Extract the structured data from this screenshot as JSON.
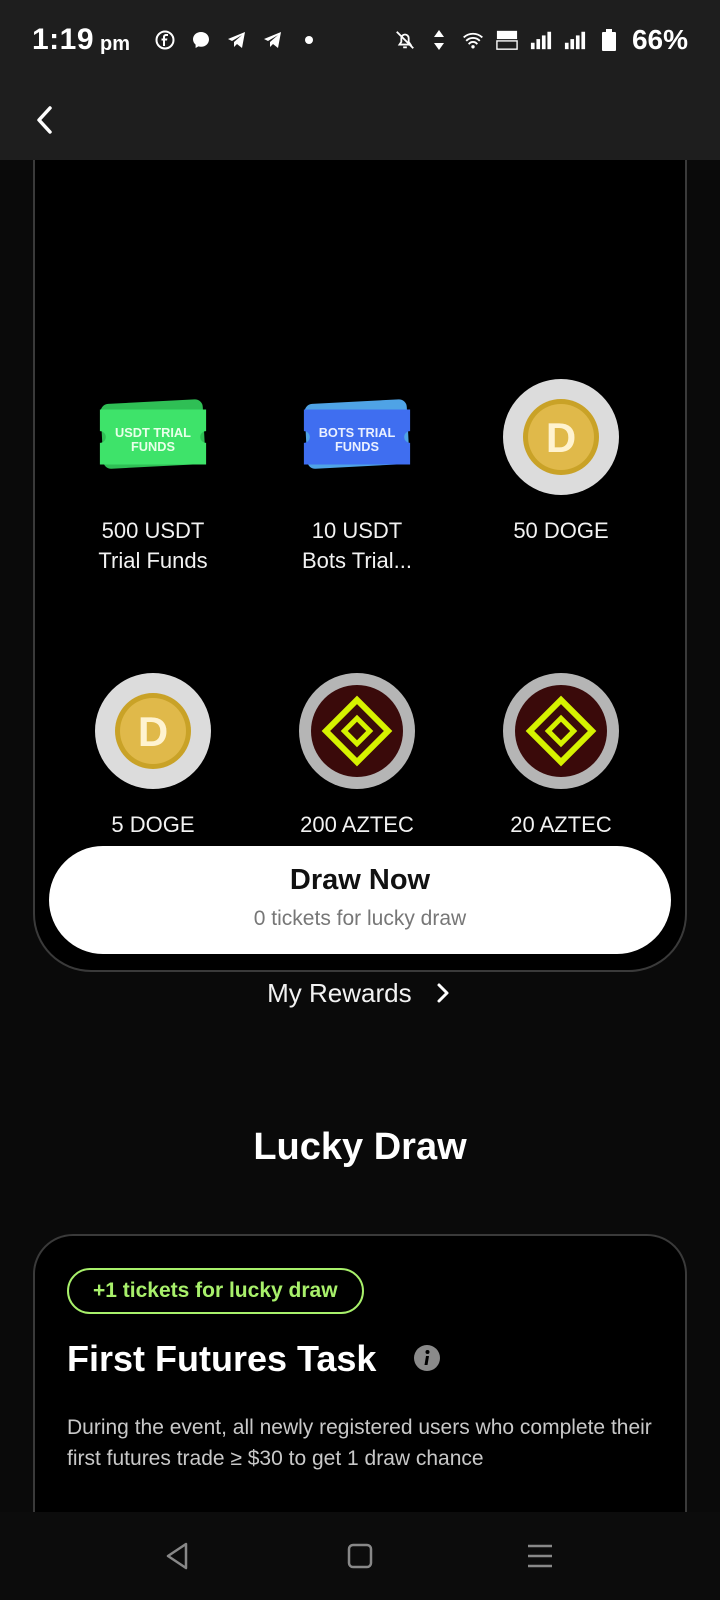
{
  "status_bar": {
    "time": "1:19",
    "ampm": "pm",
    "battery": "66%",
    "left_icons": [
      "facebook-icon",
      "messenger-icon",
      "telegram-icon",
      "telegram-icon",
      "dot-icon"
    ],
    "right_icons": [
      "mute-bell-icon",
      "data-arrows-icon",
      "wifi-icon",
      "volte-icon",
      "signal-icon",
      "signal-icon",
      "battery-icon"
    ]
  },
  "nav": {
    "back_icon": "chevron-left-icon"
  },
  "prizes": [
    {
      "label_line1": "500 USDT",
      "label_line2": "Trial Funds",
      "icon": "usdt-trial-ticket-icon",
      "ticket_text_1": "USDT TRIAL",
      "ticket_text_2": "FUNDS"
    },
    {
      "label_line1": "10 USDT",
      "label_line2": "Bots Trial...",
      "icon": "bots-trial-ticket-icon",
      "ticket_text_1": "BOTS TRIAL",
      "ticket_text_2": "FUNDS"
    },
    {
      "label_line1": "50 DOGE",
      "label_line2": "",
      "icon": "doge-coin-icon"
    },
    {
      "label_line1": "5 DOGE",
      "label_line2": "",
      "icon": "doge-coin-icon"
    },
    {
      "label_line1": "200 AZTEC",
      "label_line2": "",
      "icon": "aztec-coin-icon"
    },
    {
      "label_line1": "20 AZTEC",
      "label_line2": "",
      "icon": "aztec-coin-icon"
    }
  ],
  "draw": {
    "title": "Draw Now",
    "subtitle": "0 tickets for lucky draw"
  },
  "rewards": {
    "label": "My Rewards",
    "icon": "chevron-right-icon"
  },
  "lucky_draw": {
    "section_title": "Lucky Draw",
    "task": {
      "badge": "+1 tickets for lucky draw",
      "title": "First Futures Task",
      "info_icon": "info-icon",
      "description": "During the event, all newly registered users who complete their first futures trade ≥ $30 to get 1 draw chance"
    }
  },
  "colors": {
    "background": "#0a0a0a",
    "accent_green": "#a8f06b",
    "usdt_ticket": "#3ee36a",
    "bots_ticket": "#3f6ef0",
    "doge_gold": "#c9a227",
    "aztec_yellow": "#d6f200",
    "aztec_dark": "#3a0a0a"
  }
}
